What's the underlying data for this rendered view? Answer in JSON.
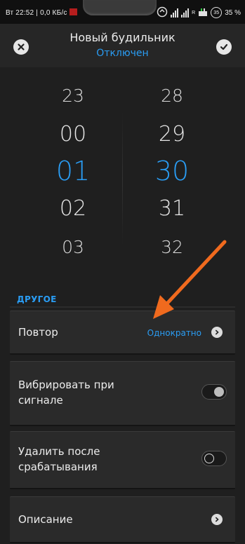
{
  "status_bar": {
    "left_text": "Вт 22:52 | 0,0 КБ/с",
    "badge": "35",
    "battery": "35 %",
    "network_small": "R"
  },
  "header": {
    "title": "Новый будильник",
    "subtitle": "Отключен",
    "cancel_icon": "close-icon",
    "confirm_icon": "check-icon"
  },
  "picker": {
    "hours": [
      "23",
      "00",
      "01",
      "02",
      "03"
    ],
    "minutes": [
      "28",
      "29",
      "30",
      "31",
      "32"
    ],
    "selected_hour": "01",
    "selected_minute": "30"
  },
  "section": {
    "title": "ДРУГОЕ"
  },
  "rows": {
    "repeat": {
      "label": "Повтор",
      "value": "Однократно"
    },
    "vibrate": {
      "label_line1": "Вибрировать при",
      "label_line2": "сигнале",
      "enabled": true
    },
    "delete_after": {
      "label_line1": "Удалить после",
      "label_line2": "срабатывания",
      "enabled": false
    },
    "description": {
      "label": "Описание"
    }
  },
  "colors": {
    "accent": "#2a9df4",
    "background": "#1f1f1f",
    "card": "#2a2a2a",
    "annotation_arrow": "#f06a1e"
  }
}
